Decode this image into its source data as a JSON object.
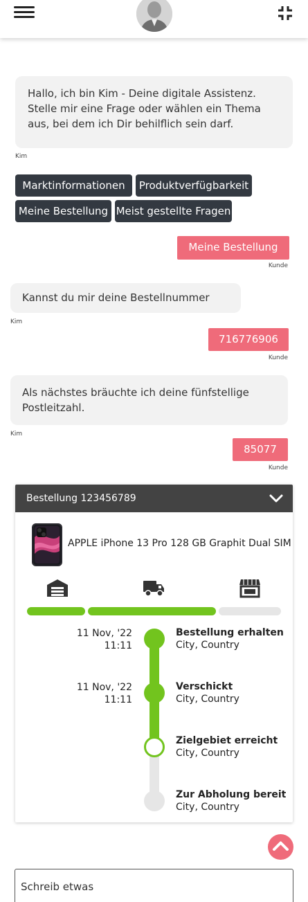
{
  "header": {
    "menu_icon": "hamburger-menu-icon",
    "avatar_icon": "assistant-avatar",
    "minimize_icon": "collapse-arrows-icon"
  },
  "chat": {
    "greeting": "Hallo, ich bin Kim - Deine digitale Assistenz. Stelle mir eine Frage oder wählen ein Thema aus, bei dem ich Dir behilflich sein darf.",
    "bot_name": "Kim",
    "user_name": "Kunde",
    "topics": [
      "Marktinformationen",
      "Produktverfügbarkeit",
      "Meine Bestellung",
      "Meist gestellte Fragen"
    ],
    "user_msg_1": "Meine Bestellung",
    "bot_msg_2": "Kannst du mir deine Bestellnummer",
    "user_msg_2": "716776906",
    "bot_msg_3": "Als nächstes bräuchte ich deine fünfstellige Postleitzahl.",
    "user_msg_3": "85077"
  },
  "order": {
    "title": "Bestellung 123456789",
    "product_name": "APPLE iPhone 13 Pro 128 GB Graphit Dual SIM",
    "stages": [
      "warehouse-icon",
      "delivery-truck-icon",
      "store-icon"
    ],
    "progress_fraction": 0.75,
    "events": [
      {
        "date": "11 Nov, '22",
        "time": "11:11",
        "title": "Bestellung erhalten",
        "location": "City, Country",
        "status": "done"
      },
      {
        "date": "11 Nov, '22",
        "time": "11:11",
        "title": "Verschickt",
        "location": "City, Country",
        "status": "done"
      },
      {
        "date": "",
        "time": "",
        "title": "Zielgebiet erreicht",
        "location": "City, Country",
        "status": "current"
      },
      {
        "date": "",
        "time": "",
        "title": "Zur Abholung bereit",
        "location": "City, Country",
        "status": "pending"
      }
    ]
  },
  "input": {
    "placeholder": "Schreib etwas"
  },
  "colors": {
    "accent": "#ef6b7a",
    "chip": "#333941",
    "progress": "#72c41e",
    "card_header": "#434343"
  }
}
